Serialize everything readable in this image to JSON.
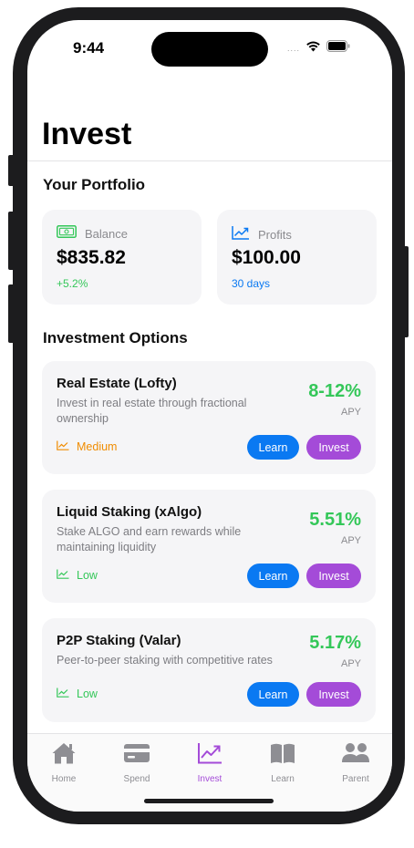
{
  "status_bar": {
    "time": "9:44",
    "signal": "....",
    "icons": [
      "wifi-icon",
      "battery-icon"
    ]
  },
  "header": {
    "title": "Invest"
  },
  "portfolio": {
    "title": "Your Portfolio",
    "balance": {
      "label": "Balance",
      "value": "$835.82",
      "change": "+5.2%",
      "icon": "cash-icon"
    },
    "profits": {
      "label": "Profits",
      "value": "$100.00",
      "period": "30 days",
      "icon": "trend-up-icon"
    }
  },
  "options": {
    "title": "Investment Options",
    "items": [
      {
        "title": "Real Estate (Lofty)",
        "description": "Invest in real estate through fractional ownership",
        "rate": "8-12%",
        "rate_unit": "APY",
        "risk": "Medium",
        "risk_color": "#f08c00",
        "learn_label": "Learn",
        "invest_label": "Invest"
      },
      {
        "title": "Liquid Staking (xAlgo)",
        "description": "Stake ALGO and earn rewards while maintaining liquidity",
        "rate": "5.51%",
        "rate_unit": "APY",
        "risk": "Low",
        "risk_color": "#34c759",
        "learn_label": "Learn",
        "invest_label": "Invest"
      },
      {
        "title": "P2P Staking (Valar)",
        "description": "Peer-to-peer staking with competitive rates",
        "rate": "5.17%",
        "rate_unit": "APY",
        "risk": "Low",
        "risk_color": "#34c759",
        "learn_label": "Learn",
        "invest_label": "Invest"
      }
    ]
  },
  "tabbar": {
    "tabs": [
      {
        "label": "Home",
        "icon": "house-icon",
        "active": false
      },
      {
        "label": "Spend",
        "icon": "credit-card-icon",
        "active": false
      },
      {
        "label": "Invest",
        "icon": "chart-trend-icon",
        "active": true
      },
      {
        "label": "Learn",
        "icon": "book-icon",
        "active": false
      },
      {
        "label": "Parent",
        "icon": "people-icon",
        "active": false
      }
    ]
  },
  "colors": {
    "accent_purple": "#a44bd8",
    "accent_blue": "#0a79f2",
    "positive_green": "#34c759",
    "warning_orange": "#f08c00",
    "card_bg": "#f5f5f7"
  }
}
